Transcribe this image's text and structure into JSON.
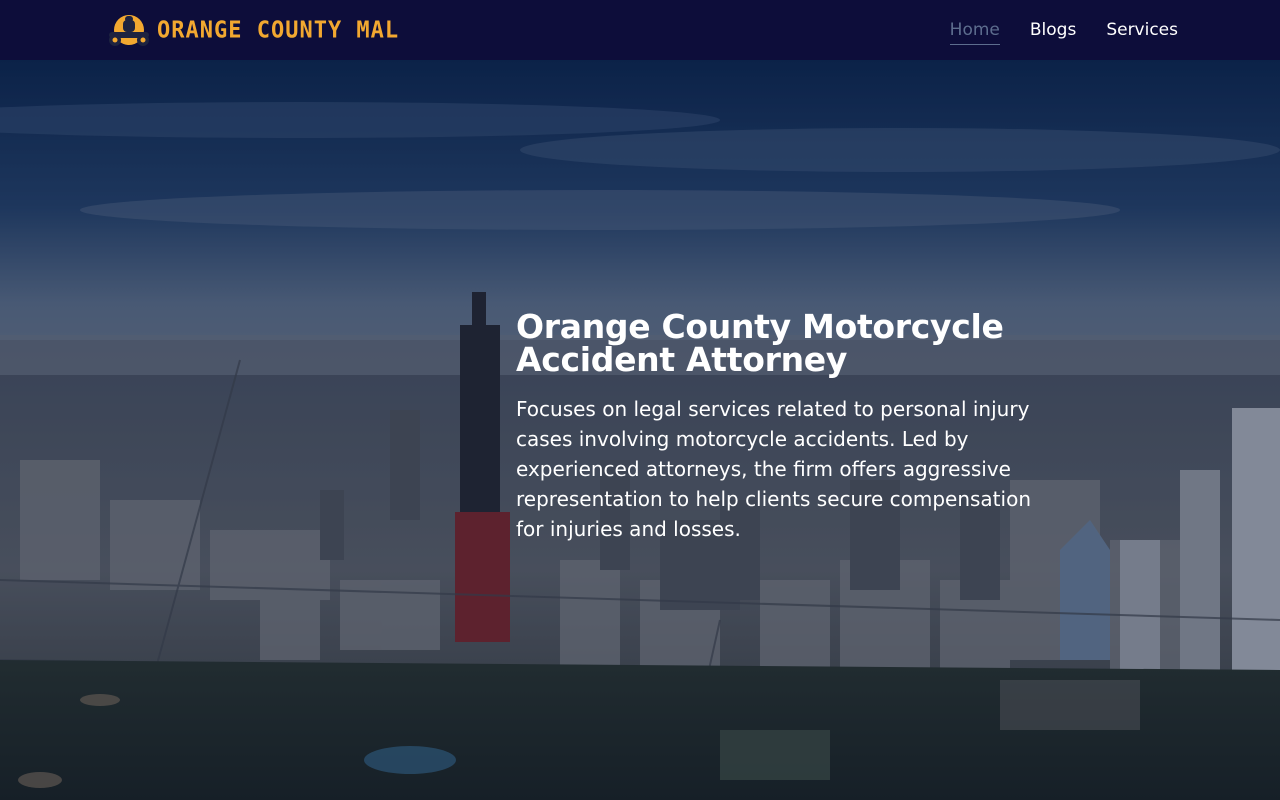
{
  "brand": {
    "name": "ORANGE COUNTY MAL",
    "accent": "#f2a830"
  },
  "nav": {
    "items": [
      {
        "label": "Home",
        "active": true
      },
      {
        "label": "Blogs",
        "active": false
      },
      {
        "label": "Services",
        "active": false
      }
    ]
  },
  "hero": {
    "title": "Orange County Motorcycle Accident Attorney",
    "description": "Focuses on legal services related to personal injury cases involving motorcycle accidents. Led by experienced attorneys, the firm offers aggressive representation to help clients secure compensation for injuries and losses."
  },
  "colors": {
    "navbar_bg": "#0d0d3a",
    "nav_active": "#5d6d8e",
    "text": "#ffffff"
  }
}
